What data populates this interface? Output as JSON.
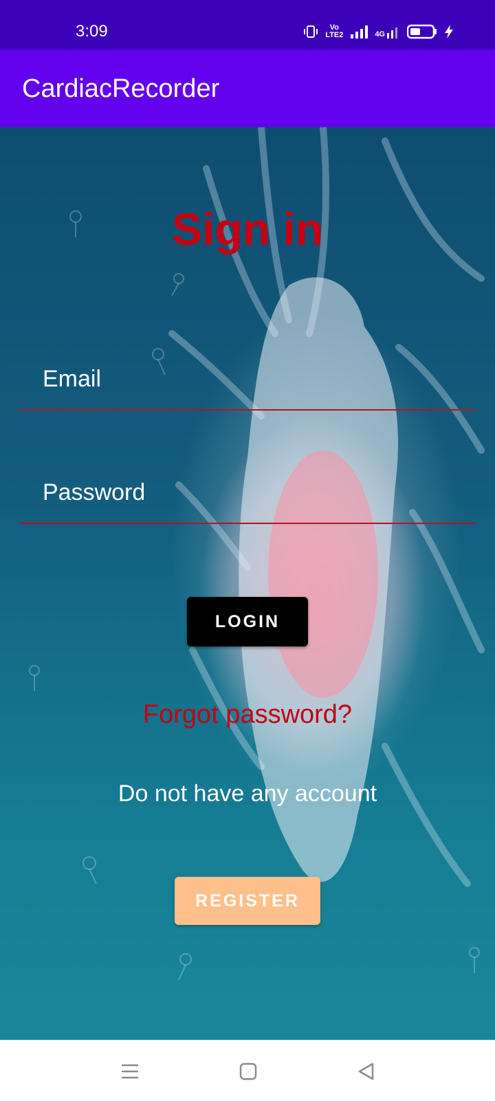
{
  "status_bar": {
    "time": "3:09",
    "icons": [
      "vibrate-icon",
      "volte-icon",
      "signal-icon",
      "4g-signal-icon",
      "battery-icon",
      "charging-icon"
    ],
    "volte_label": "Vo LTE2",
    "network_label": "4G"
  },
  "app_bar": {
    "title": "CardiacRecorder"
  },
  "signin": {
    "title": "Sign in",
    "email_placeholder": "Email",
    "password_placeholder": "Password",
    "login_label": "LOGIN",
    "forgot_label": "Forgot password?",
    "no_account_text": "Do not have any account",
    "register_label": "REGISTER"
  },
  "nav_bar": {
    "buttons": [
      "menu-icon",
      "home-square-icon",
      "back-triangle-icon"
    ]
  },
  "colors": {
    "status_bar": "#3c00b8",
    "app_bar": "#6200ee",
    "title_red": "#c40012",
    "field_underline": "#b5141f",
    "login_bg": "#000000",
    "register_bg": "#ffbf8a"
  }
}
